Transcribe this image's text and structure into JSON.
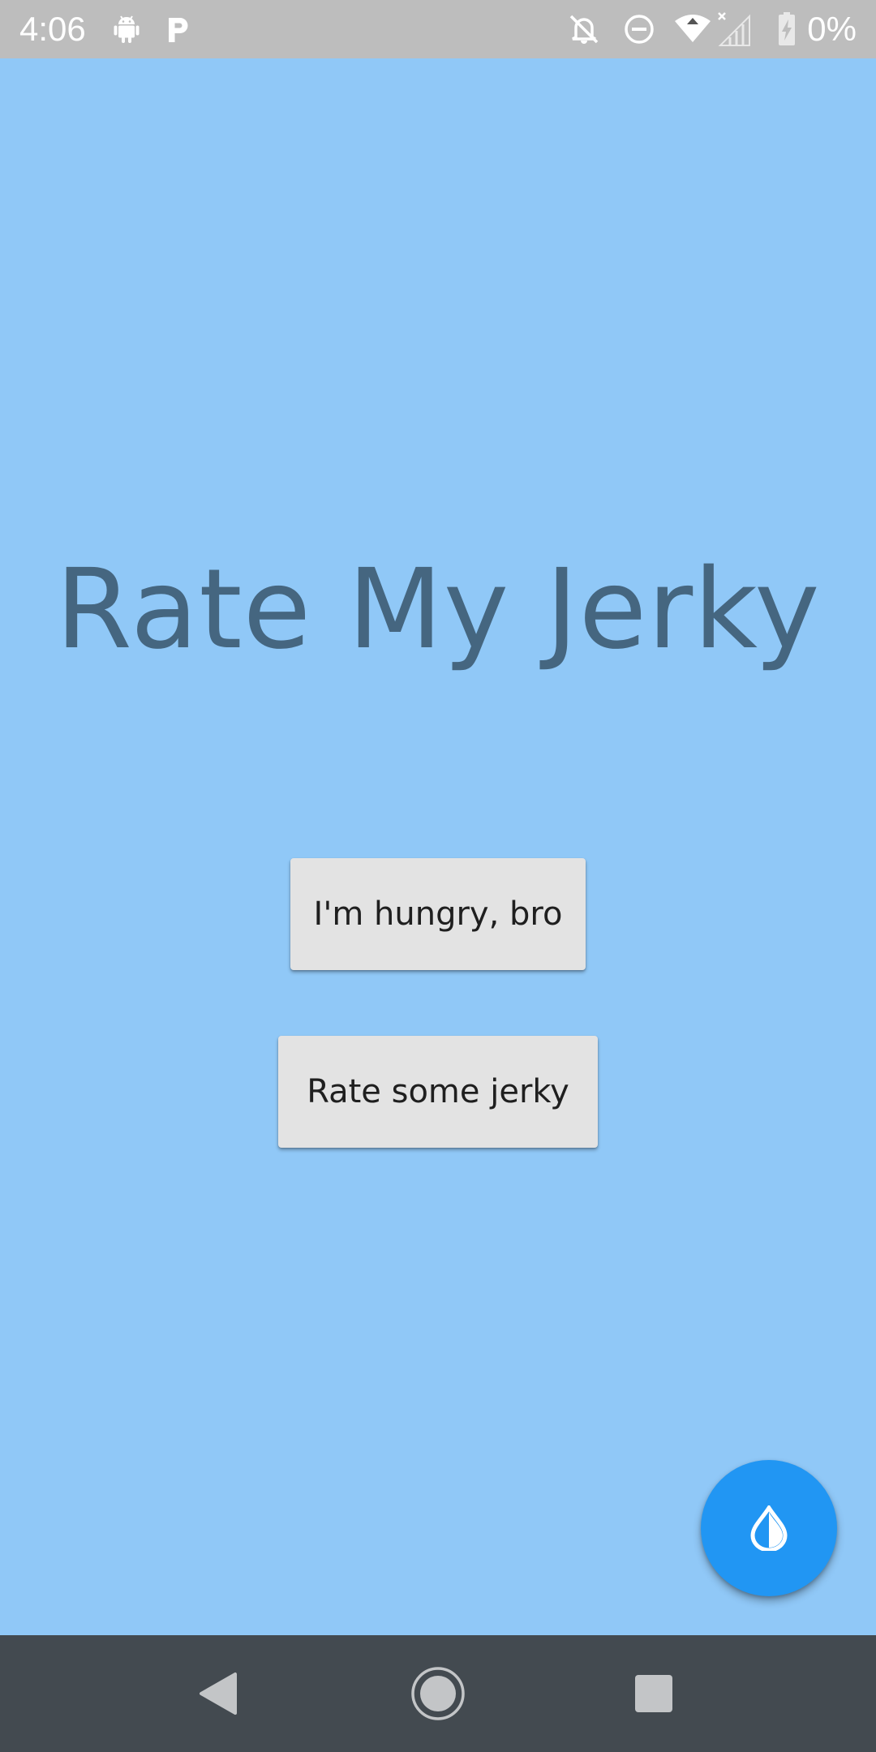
{
  "status_bar": {
    "time": "4:06",
    "battery_percent": "0%",
    "icons": [
      "android-icon",
      "parking-app-icon",
      "notifications-off-icon",
      "do-not-disturb-icon",
      "wifi-icon",
      "signal-no-service-icon",
      "battery-charging-icon"
    ]
  },
  "main": {
    "title": "Rate My Jerky",
    "buttons": {
      "hungry_label": "I'm hungry, bro",
      "rate_label": "Rate some jerky"
    },
    "fab_icon": "water-drop-icon"
  },
  "nav_bar": {
    "icons": [
      "back-icon",
      "home-icon",
      "recents-icon"
    ]
  },
  "colors": {
    "background": "#90c8f7",
    "title_text": "#456680",
    "button_bg": "#e3e3e3",
    "fab": "#2196f3",
    "status_bar": "#bdbdbd",
    "nav_bar": "#434a50"
  }
}
